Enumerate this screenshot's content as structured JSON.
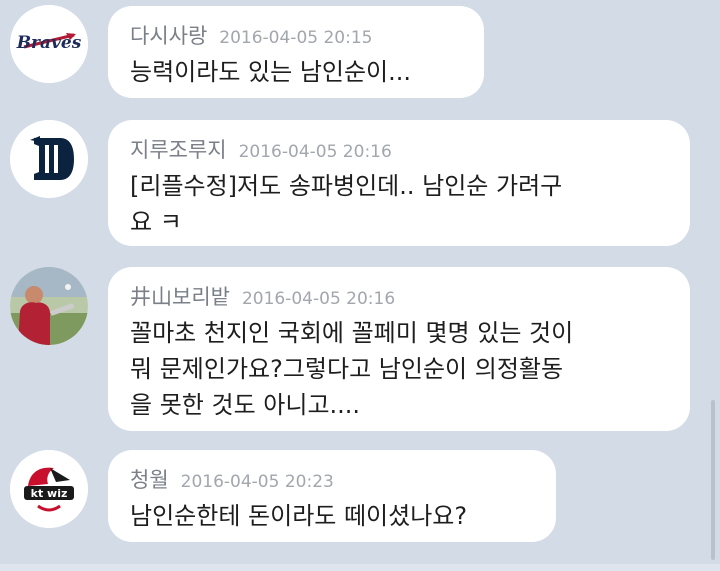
{
  "comments": [
    {
      "nick": "다시사랑",
      "time": "2016-04-05 20:15",
      "text": "능력이라도 있는 남인순이...",
      "avatar": "braves-logo-icon"
    },
    {
      "nick": "지루조루지",
      "time": "2016-04-05 20:16",
      "text": "[리플수정]저도 송파병인데.. 남인순 가려구\n요 ㅋ",
      "avatar": "tigers-logo-icon"
    },
    {
      "nick": "井山보리밭",
      "time": "2016-04-05 20:16",
      "text": "꼴마초 천지인 국회에 꼴페미 몇명 있는 것이\n뭐 문제인가요?그렇다고 남인순이 의정활동\n을 못한 것도 아니고....",
      "avatar": "baseball-player-photo"
    },
    {
      "nick": "청월",
      "time": "2016-04-05 20:23",
      "text": "남인순한테 돈이라도 떼이셨나요?",
      "avatar": "kt-wiz-logo-icon",
      "avatar_text": "kt wiz"
    }
  ],
  "colors": {
    "background": "#d3dbe7",
    "bubble": "#ffffff",
    "nick": "#7a7f88",
    "time": "#a2a6ad",
    "text": "#1e1e1e"
  }
}
